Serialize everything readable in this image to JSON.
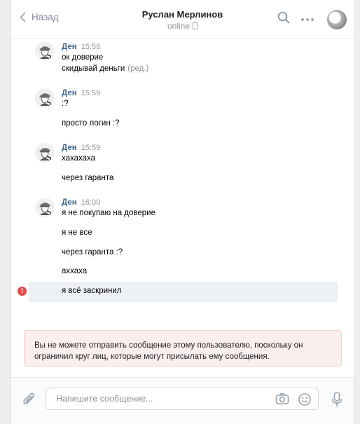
{
  "header": {
    "back_label": "Назад",
    "contact_name": "Руслан Мерлинов",
    "status": "online"
  },
  "messages": [
    {
      "author": "Ден",
      "time": "15:58",
      "lines": [
        "ок доверие",
        "скидывай деньги"
      ],
      "edited_label": "(ред.)"
    },
    {
      "author": "Ден",
      "time": "15:59",
      "lines": [
        ":?",
        "просто логин :?"
      ]
    },
    {
      "author": "Ден",
      "time": "15:59",
      "lines": [
        "хахахаха",
        "через гаранта"
      ]
    },
    {
      "author": "Ден",
      "time": "16:00",
      "lines": [
        "я не покупаю на доверие",
        "я не все",
        "через гаранта :?",
        "аххаха",
        "я всё заскринил"
      ]
    }
  ],
  "error_mark": "!",
  "warning": "Вы не можете отправить сообщение этому пользователю, поскольку он ограничил круг лиц, которые могут присылать ему сообщения.",
  "composer": {
    "placeholder": "Напишите сообщение..."
  },
  "colors": {
    "author": "#42648b",
    "time": "#939393",
    "warning_bg": "#fbeeee",
    "error": "#e64646"
  }
}
